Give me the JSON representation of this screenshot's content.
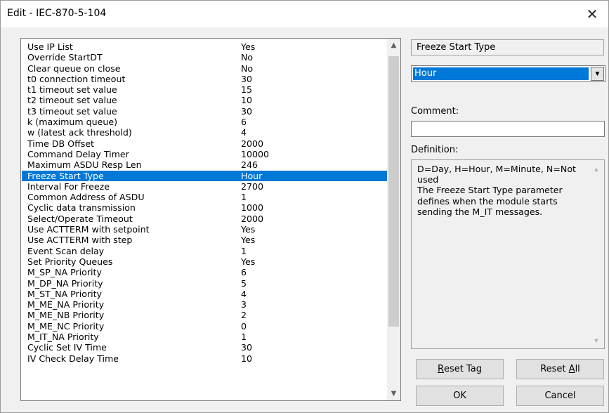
{
  "window": {
    "title": "Edit - IEC-870-5-104",
    "close_glyph": "✕"
  },
  "parameters": [
    {
      "name": "Use IP List",
      "value": "Yes"
    },
    {
      "name": "Override StartDT",
      "value": "No"
    },
    {
      "name": "Clear queue on close",
      "value": "No"
    },
    {
      "name": "t0 connection timeout",
      "value": "30"
    },
    {
      "name": "t1 timeout set value",
      "value": "15"
    },
    {
      "name": "t2 timeout set value",
      "value": "10"
    },
    {
      "name": "t3 timeout set value",
      "value": "30"
    },
    {
      "name": "k (maximum queue)",
      "value": "6"
    },
    {
      "name": "w (latest ack threshold)",
      "value": "4"
    },
    {
      "name": "Time DB Offset",
      "value": "2000"
    },
    {
      "name": "Command Delay Timer",
      "value": "10000"
    },
    {
      "name": "Maximum ASDU Resp Len",
      "value": "246"
    },
    {
      "name": "Freeze Start Type",
      "value": "Hour",
      "selected": true
    },
    {
      "name": "Interval For Freeze",
      "value": "2700"
    },
    {
      "name": "Common Address of ASDU",
      "value": "1"
    },
    {
      "name": "Cyclic data transmission",
      "value": "1000"
    },
    {
      "name": "Select/Operate Timeout",
      "value": "2000"
    },
    {
      "name": "Use ACTTERM with setpoint",
      "value": "Yes"
    },
    {
      "name": "Use ACTTERM with step",
      "value": "Yes"
    },
    {
      "name": "Event Scan delay",
      "value": "1"
    },
    {
      "name": "Set Priority Queues",
      "value": "Yes"
    },
    {
      "name": "M_SP_NA Priority",
      "value": "6"
    },
    {
      "name": "M_DP_NA Priority",
      "value": "5"
    },
    {
      "name": "M_ST_NA Priority",
      "value": "4"
    },
    {
      "name": "M_ME_NA Priority",
      "value": "3"
    },
    {
      "name": "M_ME_NB Priority",
      "value": "2"
    },
    {
      "name": "M_ME_NC Priority",
      "value": "0"
    },
    {
      "name": "M_IT_NA Priority",
      "value": "1"
    },
    {
      "name": "Cyclic Set IV Time",
      "value": "30"
    },
    {
      "name": "IV Check Delay Time",
      "value": "10"
    }
  ],
  "right_panel": {
    "param_name": "Freeze Start Type",
    "value_select": "Hour",
    "comment_label": "Comment:",
    "comment_value": "",
    "definition_label": "Definition:",
    "definition_text": "D=Day, H=Hour, M=Minute, N=Not used\nThe Freeze Start Type parameter defines when the module starts sending the M_IT messages."
  },
  "buttons": {
    "reset_tag_mnemonic": "R",
    "reset_tag_rest": "eset Tag",
    "reset_all_prefix": "Reset ",
    "reset_all_mnemonic": "A",
    "reset_all_rest": "ll",
    "ok": "OK",
    "cancel": "Cancel"
  },
  "colors": {
    "selection": "#0078d7",
    "dialog_bg": "#f0f0f0"
  }
}
